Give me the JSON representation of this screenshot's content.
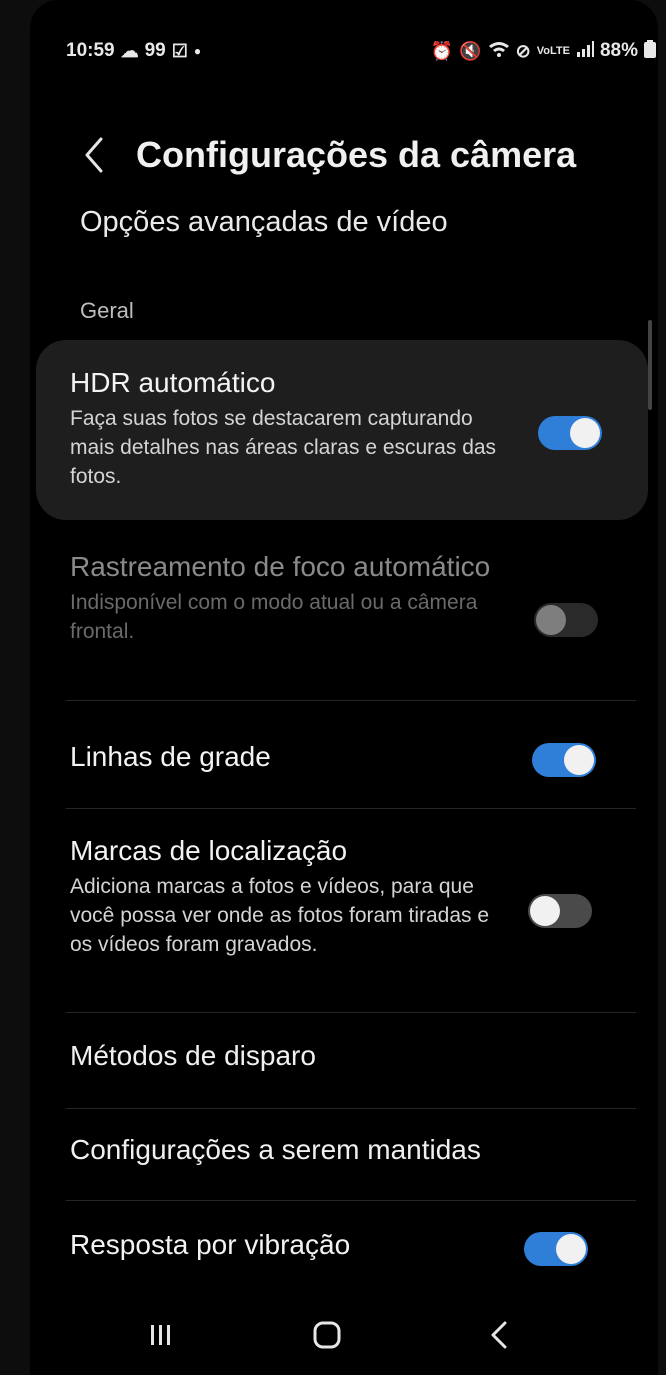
{
  "status_bar": {
    "time": "10:59",
    "notification_count": "99",
    "battery": "88%"
  },
  "header": {
    "title": "Configurações da câmera"
  },
  "page": {
    "subtitle": "Opções avançadas de vídeo",
    "section_label": "Geral"
  },
  "settings": {
    "hdr": {
      "title": "HDR automático",
      "description": "Faça suas fotos se destacarem capturando mais detalhes nas áreas claras e escuras das fotos.",
      "enabled": true
    },
    "focus_tracking": {
      "title": "Rastreamento de foco automático",
      "description": "Indisponível com o modo atual ou a câmera frontal.",
      "enabled": false,
      "available": false
    },
    "grid_lines": {
      "title": "Linhas de grade",
      "enabled": true
    },
    "location_tags": {
      "title": "Marcas de localização",
      "description": "Adiciona marcas a fotos e vídeos, para que você possa ver onde as fotos foram tiradas e os vídeos foram gravados.",
      "enabled": false
    },
    "shooting_methods": {
      "title": "Métodos de disparo"
    },
    "settings_to_keep": {
      "title": "Configurações a serem mantidas"
    },
    "vibration_feedback": {
      "title": "Resposta por vibração",
      "enabled": true
    }
  },
  "colors": {
    "toggle_on": "#2f7ed8",
    "background": "#000000",
    "card_highlight": "#1e1e1e"
  },
  "icons": {
    "back": "chevron-left-icon",
    "nav_recents": "recent-apps-icon",
    "nav_home": "home-icon",
    "nav_back": "nav-back-icon"
  }
}
